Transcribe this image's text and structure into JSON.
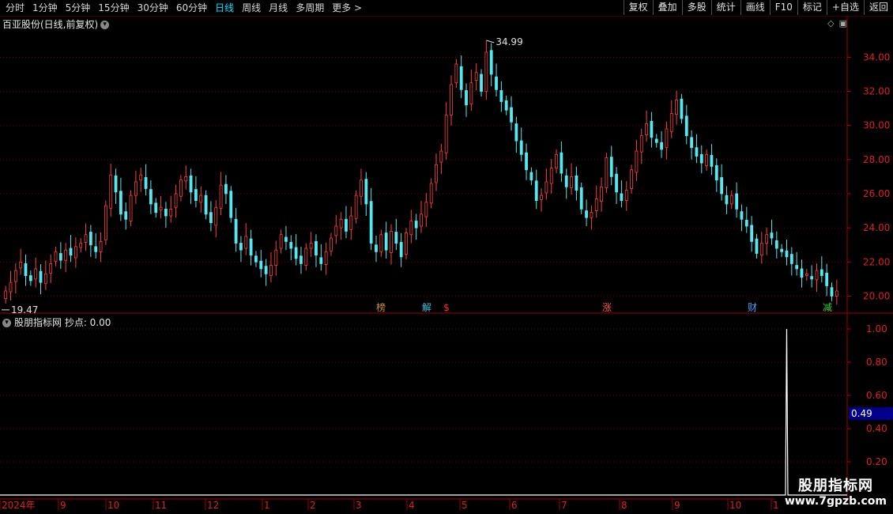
{
  "toolbar": {
    "periods": [
      "分时",
      "1分钟",
      "5分钟",
      "15分钟",
      "30分钟",
      "60分钟",
      "日线",
      "周线",
      "月线",
      "多周期",
      "更多 >"
    ],
    "active_period": "日线",
    "buttons": [
      "复权",
      "叠加",
      "多股",
      "统计",
      "画线",
      "F10",
      "标记",
      "+自选",
      "返回"
    ]
  },
  "main_panel": {
    "title": "百亚股份(日线,前复权)",
    "y_ticks": [
      "34.00",
      "32.00",
      "30.00",
      "28.00",
      "26.00",
      "24.00",
      "22.00",
      "20.00"
    ],
    "high_label": "34.99",
    "low_label": "19.47",
    "markers": [
      {
        "text": "榜",
        "color": "#d09030"
      },
      {
        "text": "解",
        "color": "#40c0e0"
      },
      {
        "text": "$",
        "color": "#ff3030"
      },
      {
        "text": "涨",
        "color": "#ff5050"
      },
      {
        "text": "财",
        "color": "#40a0ff"
      },
      {
        "text": "减",
        "color": "#40d040"
      }
    ]
  },
  "indicator_panel": {
    "title": "股朋指标网  抄点: 0.00",
    "y_ticks": [
      "1.00",
      "0.80",
      "0.60",
      "0.40",
      "0.20"
    ],
    "current_value": "0.49",
    "spike_value": 1.0
  },
  "x_axis": {
    "labels": [
      "2024年",
      "9",
      "10",
      "11",
      "12",
      "1",
      "2",
      "3",
      "4",
      "5",
      "6",
      "7",
      "8",
      "9",
      "10",
      "1"
    ]
  },
  "watermark": {
    "name": "股朋指标网",
    "url": "www.7gpzb.com"
  },
  "chart_data": {
    "type": "candlestick",
    "title": "百亚股份(日线,前复权)",
    "y_range": [
      19.0,
      35.5
    ],
    "max_price": 34.99,
    "min_price": 19.47,
    "closes": [
      20.3,
      20.8,
      21.5,
      22.0,
      21.2,
      20.9,
      21.6,
      20.8,
      21.3,
      21.9,
      22.6,
      22.1,
      22.7,
      22.4,
      22.9,
      23.1,
      23.6,
      23.0,
      22.6,
      23.2,
      25.3,
      27.1,
      26.1,
      24.8,
      24.5,
      25.9,
      26.7,
      27.1,
      26.3,
      25.4,
      24.9,
      25.2,
      24.7,
      25.1,
      26.0,
      26.8,
      27.0,
      26.1,
      25.6,
      25.9,
      24.8,
      24.3,
      25.2,
      26.5,
      26.0,
      24.6,
      23.1,
      22.7,
      23.5,
      22.4,
      22.0,
      21.6,
      21.3,
      21.8,
      22.7,
      23.6,
      23.2,
      22.8,
      22.2,
      21.9,
      22.8,
      23.1,
      22.4,
      21.9,
      22.6,
      23.4,
      24.1,
      24.5,
      23.8,
      24.7,
      25.9,
      26.8,
      25.4,
      23.1,
      22.6,
      23.6,
      22.7,
      23.8,
      23.1,
      22.3,
      23.7,
      24.4,
      24.0,
      24.8,
      25.5,
      26.6,
      27.7,
      28.5,
      30.6,
      32.4,
      33.6,
      32.1,
      31.2,
      32.5,
      33.1,
      32.0,
      34.3,
      33.0,
      32.1,
      31.4,
      30.9,
      30.2,
      29.1,
      28.3,
      27.4,
      26.8,
      25.6,
      25.9,
      26.7,
      27.5,
      28.3,
      27.2,
      26.4,
      27.0,
      26.2,
      25.1,
      24.6,
      24.9,
      25.7,
      26.4,
      28.1,
      27.0,
      26.1,
      25.6,
      26.2,
      27.4,
      28.5,
      29.4,
      30.1,
      29.3,
      29.0,
      28.6,
      29.8,
      30.7,
      31.5,
      30.4,
      29.4,
      28.7,
      28.2,
      27.8,
      28.3,
      27.6,
      26.8,
      26.0,
      25.4,
      25.9,
      25.1,
      24.5,
      24.1,
      23.2,
      22.5,
      23.1,
      23.6,
      23.4,
      22.8,
      22.6,
      22.3,
      21.9,
      21.6,
      21.1,
      21.3,
      21.0,
      21.5,
      21.2,
      20.6,
      20.0,
      20.3
    ],
    "indicator": {
      "name": "抄点",
      "values_nonzero": [
        {
          "index": 156,
          "value": 1.0
        }
      ]
    }
  }
}
